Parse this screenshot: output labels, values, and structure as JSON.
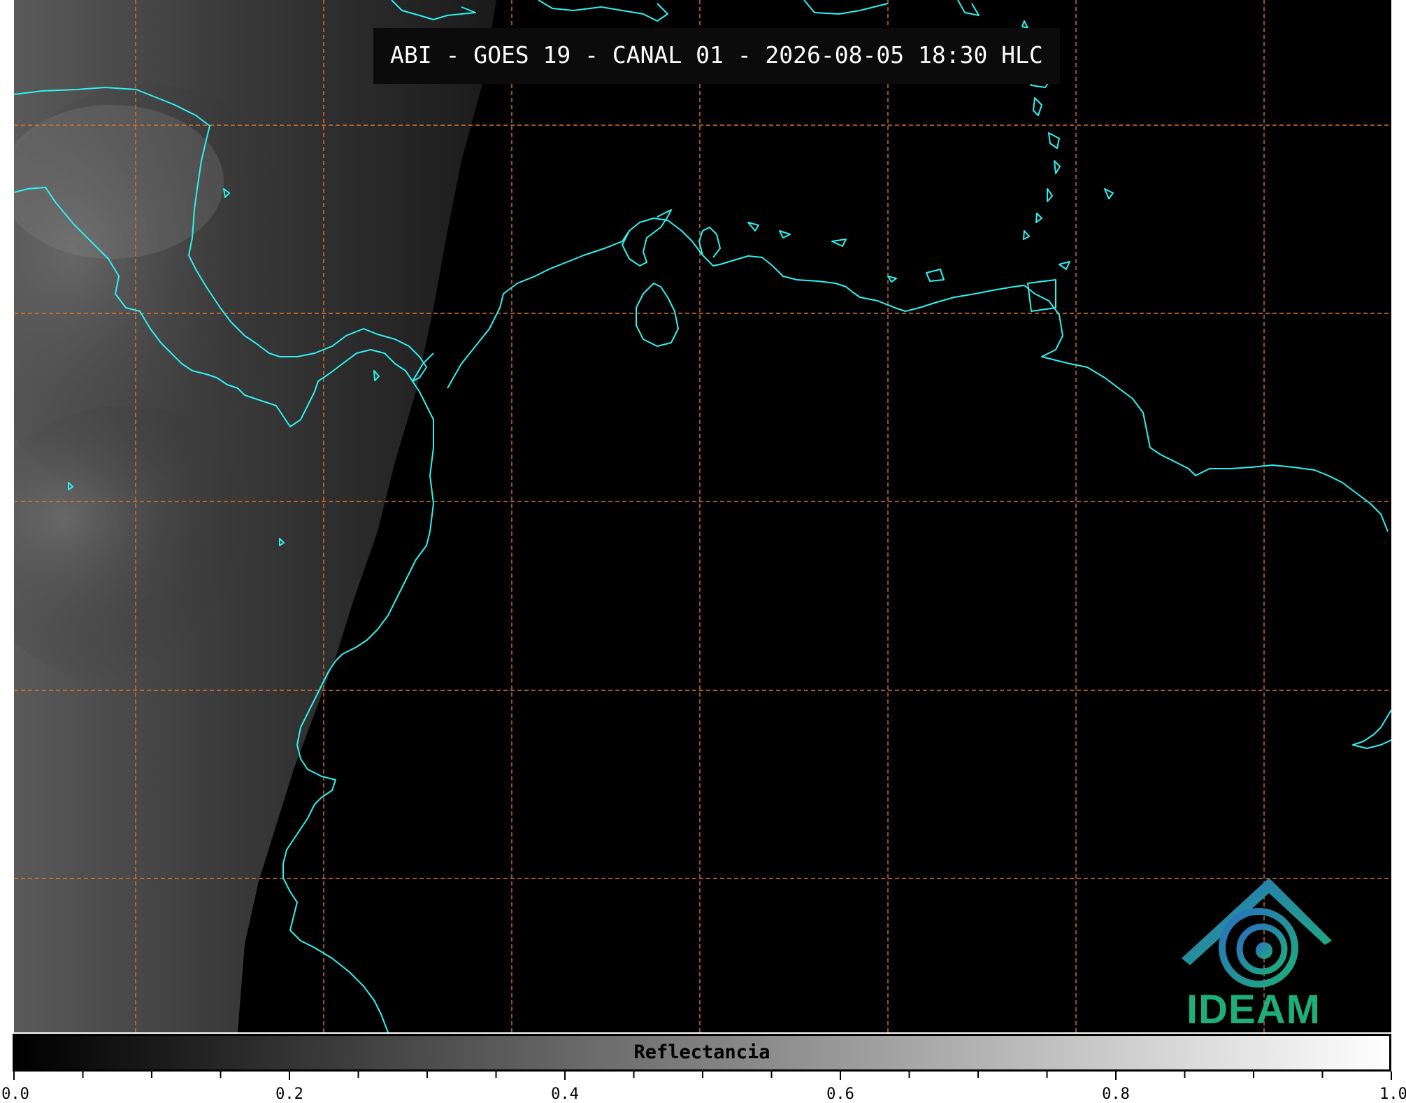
{
  "title": "ABI - GOES 19 - CANAL 01 - 2026-08-05 18:30 HLC",
  "logo": {
    "text": "IDEAM"
  },
  "map": {
    "coastline_color": "#2ef2f2",
    "graticule_color": "#d8742a",
    "graticule_style": "dashed",
    "background": "satellite visible reflectance, grayscale"
  },
  "colorbar": {
    "label": "Reflectancia",
    "min": 0.0,
    "max": 1.0,
    "tick_labels": [
      "0.0",
      "0.2",
      "0.4",
      "0.6",
      "0.8",
      "1.0"
    ],
    "color_low": "#000000",
    "color_high": "#ffffff"
  }
}
